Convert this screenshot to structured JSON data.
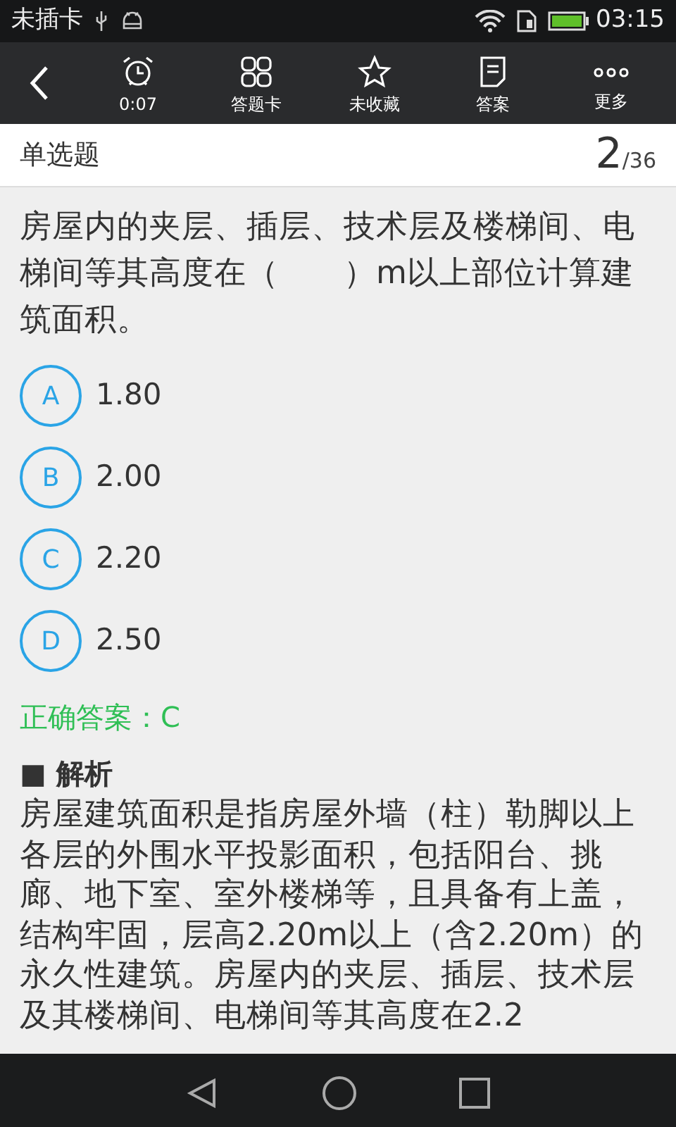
{
  "status_bar": {
    "carrier": "未插卡",
    "time": "03:15"
  },
  "toolbar": {
    "items": [
      {
        "kind": "timer",
        "label": "0:07"
      },
      {
        "kind": "card",
        "label": "答题卡"
      },
      {
        "kind": "favorite",
        "label": "未收藏",
        "selected": false
      },
      {
        "kind": "answer",
        "label": "答案"
      },
      {
        "kind": "more",
        "label": "更多"
      }
    ]
  },
  "header": {
    "type": "单选题",
    "current": "2",
    "total": "/36"
  },
  "question": "房屋内的夹层、插层、技术层及楼梯间、电梯间等其高度在（　　）m以上部位计算建筑面积。",
  "options": [
    {
      "letter": "A",
      "text": "1.80",
      "selected": false
    },
    {
      "letter": "B",
      "text": "2.00",
      "selected": false
    },
    {
      "letter": "C",
      "text": "2.20",
      "selected": false
    },
    {
      "letter": "D",
      "text": "2.50",
      "selected": false
    }
  ],
  "correct_answer": "正确答案：C",
  "analysis": {
    "title": "■ 解析",
    "text": "房屋建筑面积是指房屋外墙（柱）勒脚以上各层的外围水平投影面积，包括阳台、挑廊、地下室、室外楼梯等，且具备有上盖，结构牢固，层高2.20m以上（含2.20m）的永久性建筑。房屋内的夹层、插层、技术层及其楼梯间、电梯间等其高度在2.2"
  }
}
